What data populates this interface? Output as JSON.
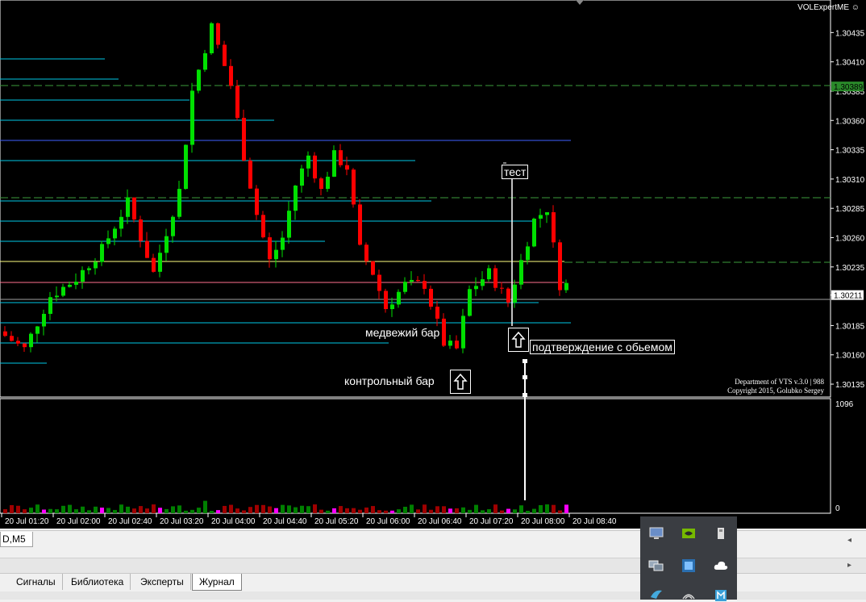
{
  "indicator_name": "VOLExpertME ☺",
  "copyright": {
    "line1": "Department of VTS  v.3.0 | 988",
    "line2": "Copyright 2015, Golubko Sergey"
  },
  "annotations": {
    "test": "тест",
    "bearish_bar": "медвежий бар",
    "confirmation": "подтверждение с обьемом",
    "control_bar": "контрольный бар"
  },
  "volume_axis": {
    "max_label": "1096",
    "min_label": "0"
  },
  "symbol_tab": "D,M5",
  "bottom_tabs": [
    {
      "label": "Сигналы",
      "active": false
    },
    {
      "label": "Библиотека",
      "active": false
    },
    {
      "label": "Эксперты",
      "active": false
    },
    {
      "label": "Журнал",
      "active": true
    }
  ],
  "chart_data": {
    "type": "candlestick",
    "price_axis": {
      "ticks": [
        "1.30435",
        "1.30410",
        "1.30385",
        "1.30360",
        "1.30335",
        "1.30310",
        "1.30285",
        "1.30260",
        "1.30235",
        "1.30211",
        "1.30185",
        "1.30160",
        "1.30135"
      ],
      "highlight_labels": {
        "green": "1.30389",
        "current": "1.30211"
      },
      "range": [
        1.30124,
        1.30449
      ]
    },
    "time_axis": {
      "ticks": [
        "20 Jul 01:20",
        "20 Jul 02:00",
        "20 Jul 02:40",
        "20 Jul 03:20",
        "20 Jul 04:00",
        "20 Jul 04:40",
        "20 Jul 05:20",
        "20 Jul 06:00",
        "20 Jul 06:40",
        "20 Jul 07:20",
        "20 Jul 08:00",
        "20 Jul 08:40"
      ]
    },
    "bull_color": "#00e000",
    "bear_color": "#ff0000",
    "volume_colors": {
      "up": "#008000",
      "down": "#a00000",
      "spike": "#ff00ff"
    }
  },
  "colors": {
    "background": "#000000",
    "axis_text": "#ffffff",
    "level_cyan": "#00c8e6",
    "level_blue": "#4060ff",
    "level_pink": "#ff7090",
    "level_green_dash": "#3c9c3c",
    "level_yellow": "#ffff80"
  }
}
